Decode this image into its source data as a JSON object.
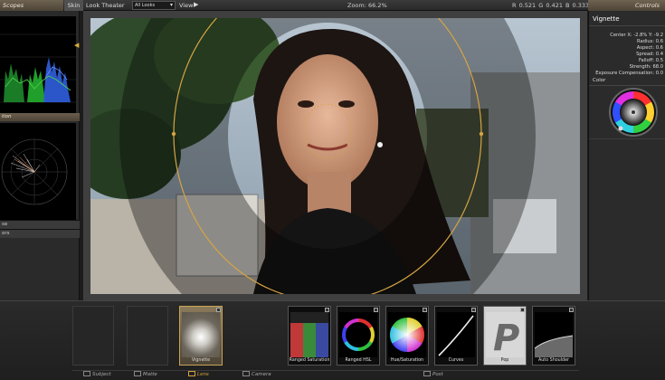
{
  "topbar": {
    "scopes_title": "Scopes",
    "skin_label": "Skin",
    "look_theater_label": "Look Theater",
    "look_select_value": "All Looks",
    "view_label": "View",
    "zoom_text": "Zoom: 66.2%",
    "rgb_text": "R 0.521   G 0.421   B 0.333",
    "controls_title": "Controls"
  },
  "scopes": {
    "bar1_label": "tion",
    "strip1_label": "se",
    "strip2_label": "ors"
  },
  "controls": {
    "tool_name": "Vignette",
    "center_label": "Center X:  -2.8%    Y:  -9.2",
    "radius_label": "Radius:  0.6",
    "aspect_label": "Aspect:  0.6",
    "spread_label": "Spread:  0.4",
    "falloff_label": "Falloff:  0.5",
    "strength_label": "Strength:  68.0",
    "exposure_label": "Exposure Compensation:  0.0",
    "color_label": "Color"
  },
  "bottom": {
    "tools": [
      {
        "label": "Vignette"
      },
      {
        "label": "Ranged Saturation"
      },
      {
        "label": "Ranged HSL"
      },
      {
        "label": "Hue/Saturation"
      },
      {
        "label": "Curves"
      },
      {
        "label": "Pop"
      },
      {
        "label": "Auto Shoulder"
      }
    ],
    "categories": {
      "subject": "Subject",
      "matte": "Matte",
      "lens": "Lens",
      "camera": "Camera",
      "post": "Post"
    }
  },
  "colors": {
    "accent_gold": "#d6a443",
    "panel_title": "#6e6250"
  }
}
